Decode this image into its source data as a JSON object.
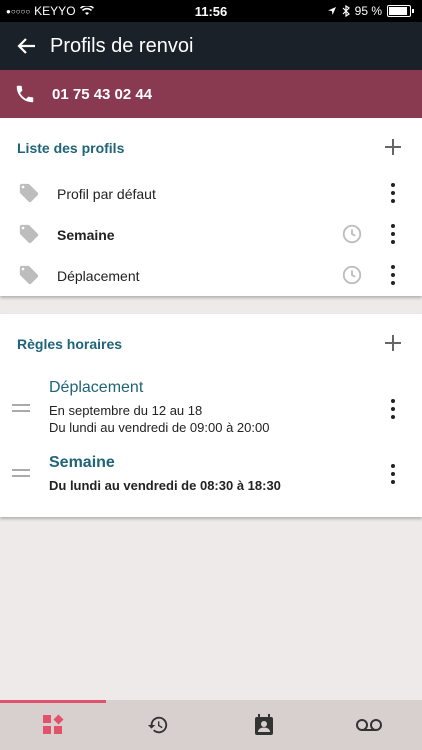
{
  "status_bar": {
    "carrier": "KEYYO",
    "time": "11:56",
    "battery": "95 %"
  },
  "app_bar": {
    "title": "Profils de renvoi",
    "back_icon": "arrow-back-icon"
  },
  "phone_banner": {
    "number": "01 75 43 02 44",
    "icon": "phone-icon",
    "color": "#8a3a50"
  },
  "profiles": {
    "title": "Liste des profils",
    "items": [
      {
        "label": "Profil par défaut",
        "bold": false,
        "scheduled": false
      },
      {
        "label": "Semaine",
        "bold": true,
        "scheduled": true
      },
      {
        "label": "Déplacement",
        "bold": false,
        "scheduled": true
      }
    ]
  },
  "rules": {
    "title": "Règles horaires",
    "items": [
      {
        "title": "Déplacement",
        "lines": [
          "En septembre du 12 au 18",
          "Du lundi au vendredi de 09:00 à 20:00"
        ],
        "bold": false
      },
      {
        "title": "Semaine",
        "lines": [
          "Du lundi au vendredi de 08:30 à 18:30"
        ],
        "bold": true
      }
    ]
  },
  "bottom_nav": {
    "items": [
      {
        "icon": "profiles-grid-icon",
        "active": true
      },
      {
        "icon": "history-icon",
        "active": false
      },
      {
        "icon": "contacts-icon",
        "active": false
      },
      {
        "icon": "voicemail-icon",
        "active": false
      }
    ]
  },
  "colors": {
    "accent": "#e0536a",
    "title_teal": "#1f6478",
    "app_bar": "#1a2128"
  }
}
